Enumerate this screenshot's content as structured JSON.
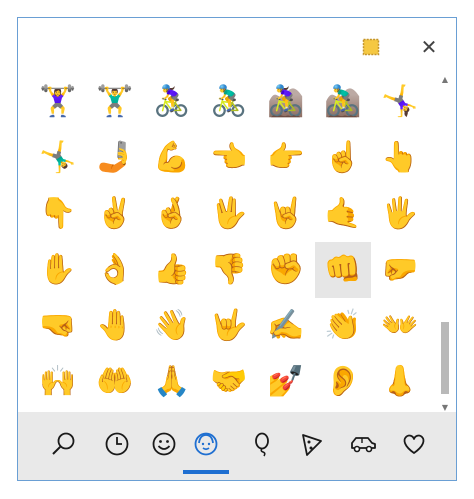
{
  "window": {
    "close_label": "✕"
  },
  "emoji_rows": [
    [
      "🏋️‍♀️",
      "🏋️‍♂️",
      "🚴‍♀️",
      "🚴‍♂️",
      "🚵‍♀️",
      "🚵‍♂️",
      "🤸‍♀️"
    ],
    [
      "🤸‍♂️",
      "🤳",
      "💪",
      "👈",
      "👉",
      "☝️",
      "👆"
    ],
    [
      "👇",
      "✌️",
      "🤞",
      "🖖",
      "🤘",
      "🤙",
      "🖐️"
    ],
    [
      "✋",
      "👌",
      "👍",
      "👎",
      "✊",
      "👊",
      "🤛"
    ],
    [
      "🤜",
      "🤚",
      "👋",
      "🤟",
      "✍️",
      "👏",
      "👐"
    ],
    [
      "🙌",
      "🤲",
      "🙏",
      "🤝",
      "💅",
      "👂",
      "👃"
    ]
  ],
  "selected_emoji": "👊",
  "categories": [
    {
      "name": "search-icon",
      "active": false
    },
    {
      "name": "clock-icon",
      "active": false
    },
    {
      "name": "smiley-icon",
      "active": false
    },
    {
      "name": "person-icon",
      "active": true
    },
    {
      "name": "balloon-icon",
      "active": false
    },
    {
      "name": "pizza-icon",
      "active": false
    },
    {
      "name": "car-icon",
      "active": false
    },
    {
      "name": "heart-icon",
      "active": false
    }
  ],
  "colors": {
    "accent": "#1f6fd1",
    "border": "#6a9fd4",
    "bottom_bar": "#e9e9e9",
    "pin_fill": "#f5c842"
  }
}
